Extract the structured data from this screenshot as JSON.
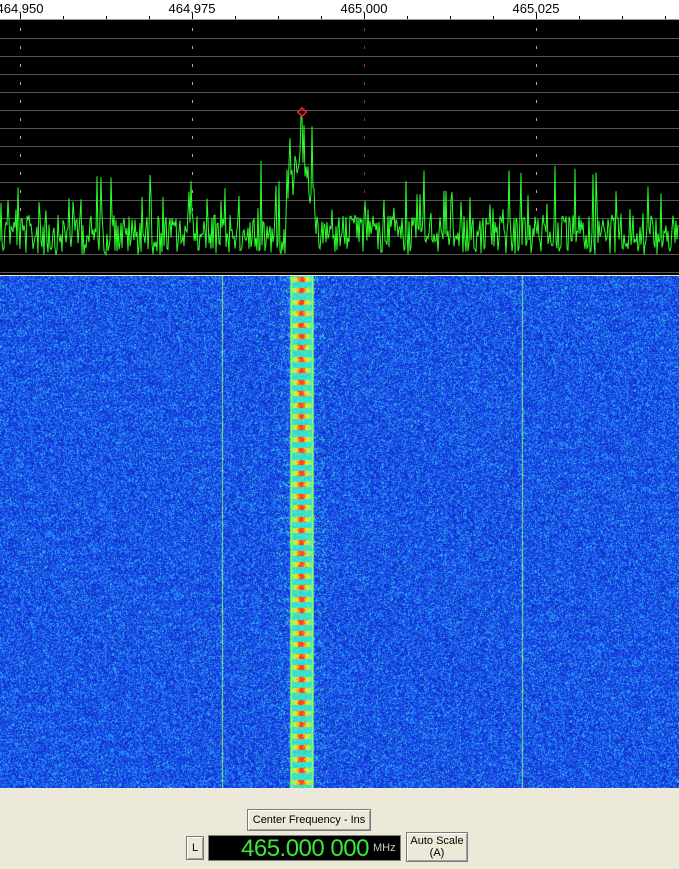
{
  "axis": {
    "ticks": [
      "464.950",
      "464.975",
      "465.000",
      "465.025"
    ]
  },
  "spectrum": {
    "peak_marker": "peak-marker-icon"
  },
  "controls": {
    "center_frequency_label": "Center Frequency - Ins",
    "lock_label": "L",
    "frequency_value": "465.000 000",
    "frequency_unit": "MHz",
    "autoscale_line1": "Auto Scale",
    "autoscale_line2": "(A)"
  },
  "colors": {
    "spectrum_trace": "#2bff2b",
    "spectrum_background": "#000000",
    "waterfall_background": "#1a3cd2",
    "peak_marker": "#ff2020",
    "center_line": "#c02020",
    "frequency_text": "#39e83a"
  }
}
